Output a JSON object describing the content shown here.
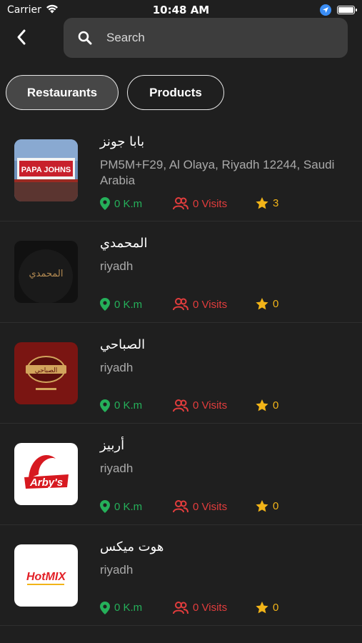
{
  "status_bar": {
    "carrier": "Carrier",
    "time": "10:48 AM"
  },
  "search": {
    "placeholder": "Search"
  },
  "tabs": [
    {
      "label": "Restaurants",
      "active": true
    },
    {
      "label": "Products",
      "active": false
    }
  ],
  "colors": {
    "background": "#1f1f1f",
    "distance": "#25b05a",
    "visits": "#e33d3d",
    "rating": "#f2b418"
  },
  "restaurants": [
    {
      "name": "بابا جونز",
      "address": "PM5M+F29, Al Olaya, Riyadh 12244, Saudi Arabia",
      "distance": "0 K.m",
      "visits": "0 Visits",
      "rating": "3",
      "logo_text": "PAPA JOHNS"
    },
    {
      "name": "المحمدي",
      "address": "riyadh",
      "distance": "0 K.m",
      "visits": "0 Visits",
      "rating": "0",
      "logo_text": "المحمدي"
    },
    {
      "name": "الصباحي",
      "address": "riyadh",
      "distance": "0 K.m",
      "visits": "0 Visits",
      "rating": "0",
      "logo_text": "الصباحي"
    },
    {
      "name": "أربيز",
      "address": "riyadh",
      "distance": "0 K.m",
      "visits": "0 Visits",
      "rating": "0",
      "logo_text": "Arby's"
    },
    {
      "name": "هوت ميكس",
      "address": "riyadh",
      "distance": "0 K.m",
      "visits": "0 Visits",
      "rating": "0",
      "logo_text": "HotMIX"
    }
  ]
}
